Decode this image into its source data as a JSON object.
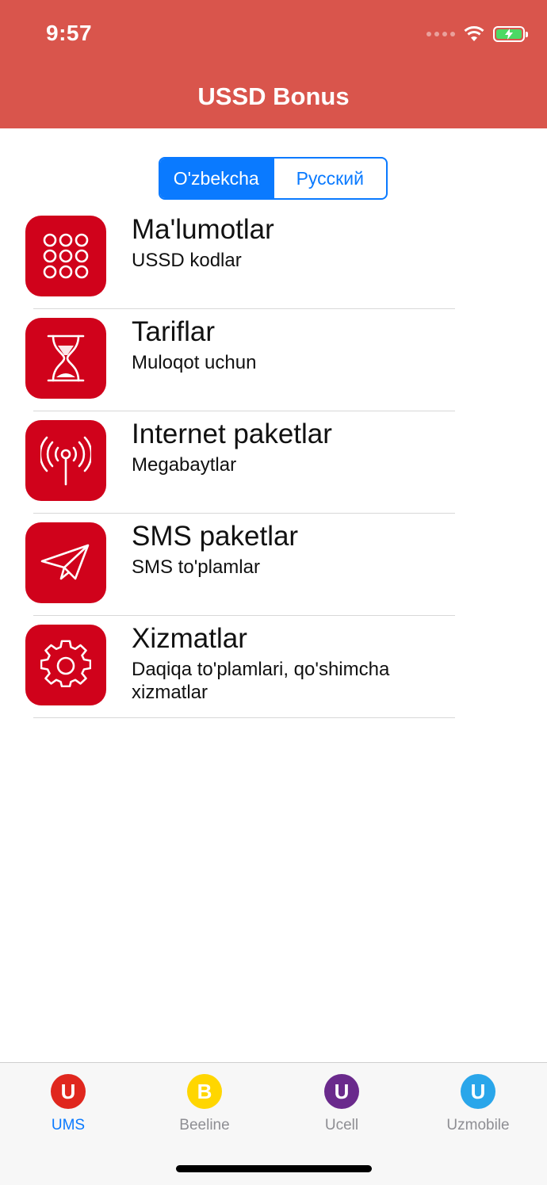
{
  "status_bar": {
    "time": "9:57"
  },
  "header": {
    "title": "USSD Bonus"
  },
  "language_toggle": {
    "options": [
      "O'zbekcha",
      "Русский"
    ],
    "selected": "O'zbekcha"
  },
  "menu": [
    {
      "title": "Ma'lumotlar",
      "subtitle": "USSD kodlar",
      "icon": "keypad-icon"
    },
    {
      "title": "Tariflar",
      "subtitle": "Muloqot uchun",
      "icon": "hourglass-icon"
    },
    {
      "title": "Internet paketlar",
      "subtitle": "Megabaytlar",
      "icon": "antenna-icon"
    },
    {
      "title": "SMS paketlar",
      "subtitle": "SMS to'plamlar",
      "icon": "paper-plane-icon"
    },
    {
      "title": "Xizmatlar",
      "subtitle": "Daqiqa to'plamlari, qo'shimcha xizmatlar",
      "icon": "gear-icon"
    }
  ],
  "tabs": [
    {
      "label": "UMS",
      "letter": "U",
      "color": "#e0271e",
      "active": true
    },
    {
      "label": "Beeline",
      "letter": "B",
      "color": "#ffd600",
      "active": false
    },
    {
      "label": "Ucell",
      "letter": "U",
      "color": "#6a2a8c",
      "active": false
    },
    {
      "label": "Uzmobile",
      "letter": "U",
      "color": "#2aa6ea",
      "active": false
    }
  ],
  "colors": {
    "header": "#d9554c",
    "accent": "#0a7aff",
    "icon_tile": "#d0021b"
  }
}
